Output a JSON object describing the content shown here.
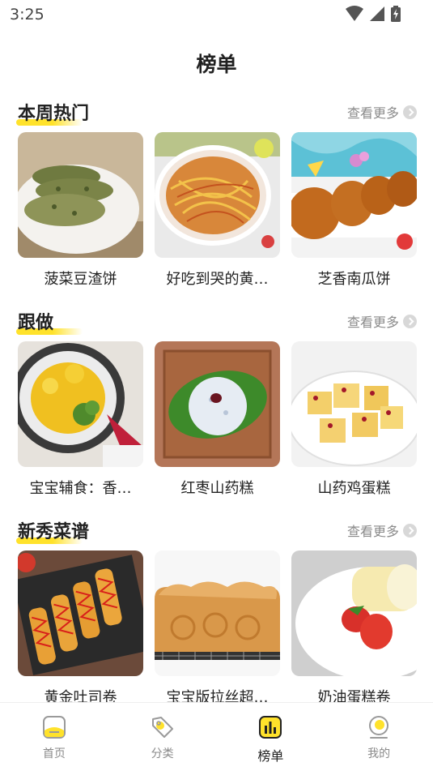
{
  "status_bar": {
    "time": "3:25"
  },
  "header": {
    "title": "榜单"
  },
  "sections": [
    {
      "title": "本周热门",
      "more_label": "查看更多",
      "cards": [
        {
          "label": "菠菜豆渣饼",
          "image": "spinach-okara-pancake-photo"
        },
        {
          "label": "好吃到哭的黄…",
          "image": "stir-fried-noodles-photo"
        },
        {
          "label": "芝香南瓜饼",
          "image": "sesame-pumpkin-cake-photo"
        }
      ]
    },
    {
      "title": "跟做",
      "more_label": "查看更多",
      "cards": [
        {
          "label": "宝宝辅食：香…",
          "image": "baby-food-egg-broccoli-photo"
        },
        {
          "label": "红枣山药糕",
          "image": "date-yam-cake-photo"
        },
        {
          "label": "山药鸡蛋糕",
          "image": "yam-egg-cake-photo"
        }
      ]
    },
    {
      "title": "新秀菜谱",
      "more_label": "查看更多",
      "cards": [
        {
          "label": "黄金吐司卷",
          "image": "golden-toast-roll-photo"
        },
        {
          "label": "宝宝版拉丝超…",
          "image": "stringy-bread-loaf-photo"
        },
        {
          "label": "奶油蛋糕卷",
          "image": "cream-cake-roll-photo"
        }
      ]
    }
  ],
  "tab_bar": {
    "active": "榜单",
    "tabs": [
      {
        "label": "首页",
        "icon": "home-icon"
      },
      {
        "label": "分类",
        "icon": "category-tag-icon"
      },
      {
        "label": "榜单",
        "icon": "ranking-chart-icon"
      },
      {
        "label": "我的",
        "icon": "profile-icon"
      }
    ]
  },
  "colors": {
    "accent": "#ffe22b",
    "text": "#222222",
    "muted": "#8a8a8a"
  }
}
